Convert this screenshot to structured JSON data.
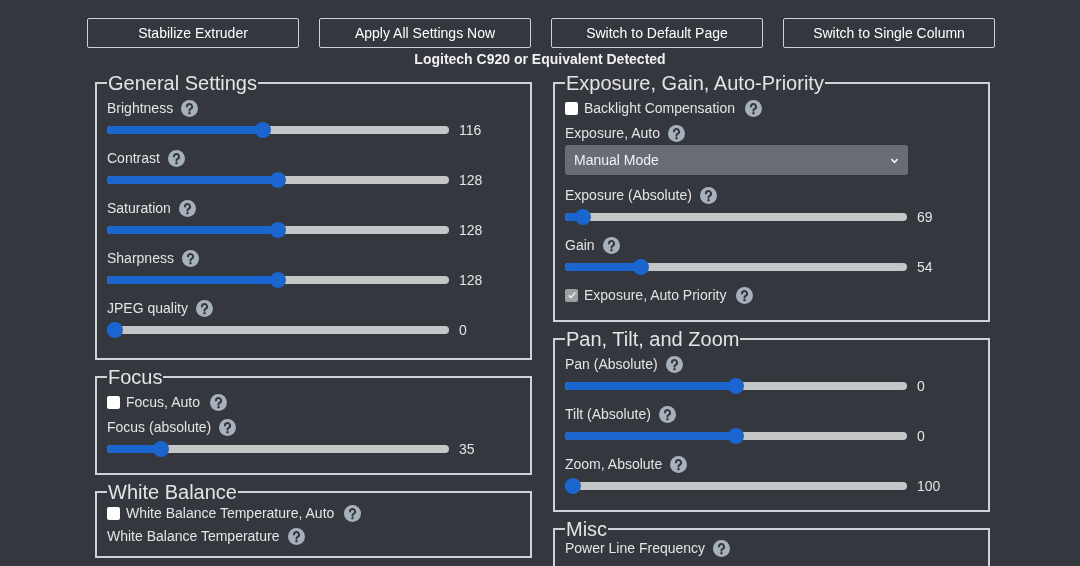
{
  "toolbar": {
    "buttons": [
      "Stabilize Extruder",
      "Apply All Settings Now",
      "Switch to Default Page",
      "Switch to Single Column"
    ]
  },
  "device_status": "Logitech C920 or Equivalent Detected",
  "columns": [
    {
      "sections": [
        {
          "title": "General Settings",
          "items": [
            {
              "kind": "slider",
              "label": "Brightness",
              "level": 0.455,
              "reading": "116"
            },
            {
              "kind": "slider",
              "label": "Contrast",
              "level": 0.5,
              "reading": "128"
            },
            {
              "kind": "slider",
              "label": "Saturation",
              "level": 0.5,
              "reading": "128"
            },
            {
              "kind": "slider",
              "label": "Sharpness",
              "level": 0.5,
              "reading": "128"
            },
            {
              "kind": "slider",
              "label": "JPEG quality",
              "level": 0,
              "reading": "0"
            }
          ]
        },
        {
          "title": "Focus",
          "items": [
            {
              "kind": "checkbox",
              "label": "Focus, Auto",
              "checked": false,
              "disabled": false
            },
            {
              "kind": "slider",
              "label": "Focus (absolute)",
              "level": 0.14,
              "reading": "35"
            }
          ]
        },
        {
          "title": "White Balance",
          "items": [
            {
              "kind": "checkbox",
              "label": "White Balance Temperature, Auto",
              "checked": false,
              "disabled": false
            },
            {
              "kind": "label",
              "label": "White Balance Temperature"
            }
          ]
        }
      ]
    },
    {
      "sections": [
        {
          "title": "Exposure, Gain, Auto-Priority",
          "items": [
            {
              "kind": "checkbox",
              "label": "Backlight Compensation",
              "checked": false,
              "disabled": false
            },
            {
              "kind": "select",
              "label": "Exposure, Auto",
              "value": "Manual Mode"
            },
            {
              "kind": "slider",
              "label": "Exposure (Absolute)",
              "level": 0.03,
              "reading": "69"
            },
            {
              "kind": "slider",
              "label": "Gain",
              "level": 0.21,
              "reading": "54"
            },
            {
              "kind": "checkbox",
              "label": "Exposure, Auto Priority",
              "checked": true,
              "disabled": true
            }
          ]
        },
        {
          "title": "Pan, Tilt, and Zoom",
          "items": [
            {
              "kind": "slider",
              "label": "Pan (Absolute)",
              "level": 0.5,
              "reading": "0"
            },
            {
              "kind": "slider",
              "label": "Tilt (Absolute)",
              "level": 0.5,
              "reading": "0"
            },
            {
              "kind": "slider",
              "label": "Zoom, Absolute",
              "level": 0,
              "reading": "100"
            }
          ]
        },
        {
          "title": "Misc",
          "items": [
            {
              "kind": "label",
              "label": "Power Line Frequency"
            }
          ]
        }
      ]
    }
  ]
}
